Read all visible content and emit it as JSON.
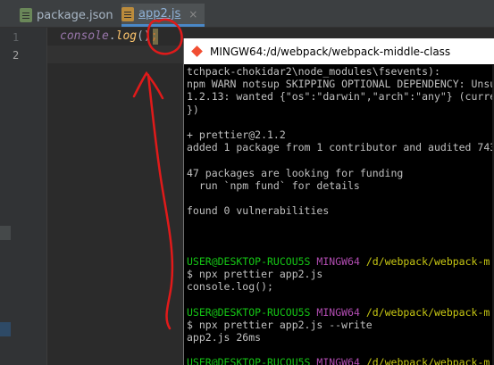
{
  "ide": {
    "tabs": [
      {
        "label": "package.json",
        "close": "×",
        "active": false
      },
      {
        "label": "app2.js",
        "close": "×",
        "active": true
      }
    ],
    "line_numbers": [
      "1",
      "2"
    ],
    "code": {
      "obj": "console",
      "dot": ".",
      "method": "log",
      "parens": "()",
      "semi": ";"
    }
  },
  "terminal": {
    "title": "MINGW64:/d/webpack/webpack-middle-class",
    "lines": [
      "tchpack-chokidar2\\node_modules\\fsevents):",
      "npm WARN notsup SKIPPING OPTIONAL DEPENDENCY: Unsu",
      "1.2.13: wanted {\"os\":\"darwin\",\"arch\":\"any\"} (curre",
      "})",
      "",
      "+ prettier@2.1.2",
      "added 1 package from 1 contributor and audited 743",
      "",
      "47 packages are looking for funding",
      "  run `npm fund` for details",
      "",
      "found 0 vulnerabilities"
    ],
    "prompt": {
      "user": "USER@DESKTOP-RUCOU5S",
      "shell": "MINGW64",
      "path": "/d/webpack/webpack-m"
    },
    "cmd1": "$ npx prettier app2.js",
    "out1": "console.log();",
    "cmd2": "$ npx prettier app2.js --write",
    "out2": "app2.js 26ms",
    "final_prompt": "$"
  },
  "colors": {
    "annotation": "#e01a1a",
    "prompt_user": "#15c715",
    "prompt_shell": "#b14cb1",
    "prompt_path": "#c8c813"
  }
}
